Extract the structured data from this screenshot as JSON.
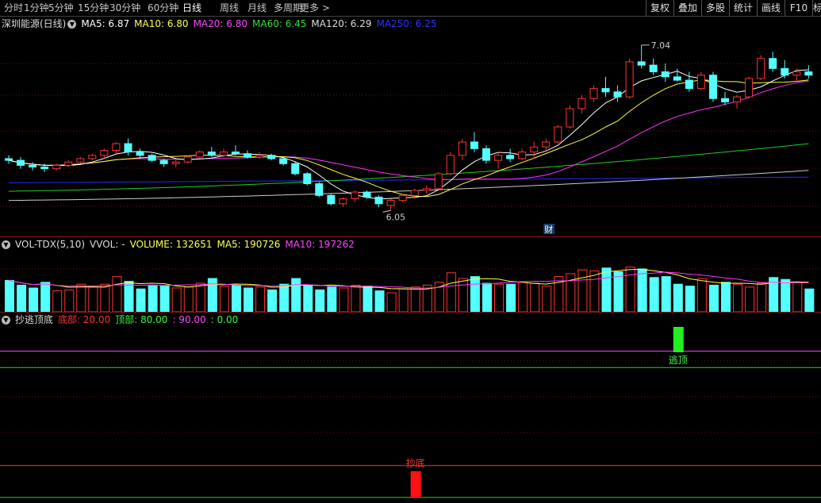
{
  "toolbar": {
    "period_tabs": [
      "分时",
      "1分钟",
      "5分钟",
      "15分钟",
      "30分钟",
      "60分钟",
      "日线",
      "周线",
      "月线",
      "多周期",
      "更多 >"
    ],
    "active_tab": "日线",
    "right_buttons": [
      "复权",
      "叠加",
      "多股",
      "统计",
      "画线",
      "F10",
      "标"
    ]
  },
  "price_panel": {
    "stock_name": "深圳能源(日线)",
    "ma_labels": [
      {
        "text": "MA5: 6.87",
        "color": "#ffffff"
      },
      {
        "text": "MA10: 6.80",
        "color": "#ffff55"
      },
      {
        "text": "MA20: 6.80",
        "color": "#ff44ff"
      },
      {
        "text": "MA60: 6.45",
        "color": "#33dd33"
      },
      {
        "text": "MA120: 6.29",
        "color": "#dddddd"
      },
      {
        "text": "MA250: 6.25",
        "color": "#3333ff"
      }
    ],
    "high_label": "7.04",
    "low_label": "6.05",
    "event_marker": "财"
  },
  "volume_panel": {
    "labels": [
      {
        "text": "VOL-TDX(5,10)",
        "color": "#dddddd"
      },
      {
        "text": "VVOL: -",
        "color": "#dddddd"
      },
      {
        "text": "VOLUME: 132651",
        "color": "#ffff55"
      },
      {
        "text": "MA5: 190726",
        "color": "#ffff55"
      },
      {
        "text": "MA10: 197262",
        "color": "#ff44ff"
      }
    ]
  },
  "signal_panel": {
    "labels": [
      {
        "text": "抄逃顶底",
        "color": "#dddddd"
      },
      {
        "text": "底部: 20.00",
        "color": "#ff3333"
      },
      {
        "text": "顶部: 80.00",
        "color": "#33ff33"
      },
      {
        "text": ": 90.00",
        "color": "#ff44ff"
      },
      {
        "text": ": 0.00",
        "color": "#33ff33"
      }
    ],
    "top_signal_label": "逃顶",
    "bottom_signal_label": "抄底"
  },
  "chart_data": {
    "type": "candlestick",
    "ylim": [
      5.98,
      7.12
    ],
    "up_color": "#ff3333",
    "down_color": "#54ffff",
    "candles": [
      [
        6.36,
        6.38,
        6.33,
        6.35
      ],
      [
        6.35,
        6.37,
        6.3,
        6.32
      ],
      [
        6.32,
        6.34,
        6.29,
        6.31
      ],
      [
        6.31,
        6.33,
        6.28,
        6.3
      ],
      [
        6.3,
        6.33,
        6.29,
        6.32
      ],
      [
        6.32,
        6.35,
        6.31,
        6.34
      ],
      [
        6.34,
        6.37,
        6.33,
        6.36
      ],
      [
        6.36,
        6.39,
        6.35,
        6.38
      ],
      [
        6.38,
        6.42,
        6.36,
        6.41
      ],
      [
        6.41,
        6.46,
        6.39,
        6.45
      ],
      [
        6.45,
        6.48,
        6.38,
        6.4
      ],
      [
        6.4,
        6.42,
        6.36,
        6.38
      ],
      [
        6.38,
        6.39,
        6.34,
        6.35
      ],
      [
        6.35,
        6.36,
        6.31,
        6.33
      ],
      [
        6.33,
        6.35,
        6.31,
        6.34
      ],
      [
        6.34,
        6.38,
        6.33,
        6.37
      ],
      [
        6.37,
        6.41,
        6.36,
        6.4
      ],
      [
        6.4,
        6.43,
        6.37,
        6.38
      ],
      [
        6.38,
        6.42,
        6.37,
        6.4
      ],
      [
        6.4,
        6.44,
        6.38,
        6.39
      ],
      [
        6.39,
        6.41,
        6.36,
        6.37
      ],
      [
        6.37,
        6.4,
        6.36,
        6.38
      ],
      [
        6.38,
        6.39,
        6.35,
        6.36
      ],
      [
        6.36,
        6.37,
        6.32,
        6.33
      ],
      [
        6.33,
        6.34,
        6.26,
        6.27
      ],
      [
        6.27,
        6.28,
        6.2,
        6.21
      ],
      [
        6.21,
        6.22,
        6.13,
        6.14
      ],
      [
        6.14,
        6.15,
        6.08,
        6.09
      ],
      [
        6.09,
        6.13,
        6.07,
        6.12
      ],
      [
        6.12,
        6.17,
        6.1,
        6.16
      ],
      [
        6.16,
        6.17,
        6.12,
        6.13
      ],
      [
        6.13,
        6.14,
        6.07,
        6.09
      ],
      [
        6.08,
        6.12,
        6.05,
        6.11
      ],
      [
        6.11,
        6.15,
        6.1,
        6.14
      ],
      [
        6.14,
        6.18,
        6.12,
        6.17
      ],
      [
        6.17,
        6.2,
        6.15,
        6.18
      ],
      [
        6.18,
        6.28,
        6.17,
        6.27
      ],
      [
        6.27,
        6.4,
        6.26,
        6.38
      ],
      [
        6.38,
        6.48,
        6.35,
        6.46
      ],
      [
        6.46,
        6.52,
        6.4,
        6.42
      ],
      [
        6.42,
        6.44,
        6.33,
        6.35
      ],
      [
        6.35,
        6.4,
        6.3,
        6.38
      ],
      [
        6.38,
        6.42,
        6.34,
        6.36
      ],
      [
        6.36,
        6.42,
        6.35,
        6.4
      ],
      [
        6.4,
        6.46,
        6.36,
        6.43
      ],
      [
        6.43,
        6.48,
        6.4,
        6.46
      ],
      [
        6.46,
        6.56,
        6.45,
        6.55
      ],
      [
        6.55,
        6.68,
        6.54,
        6.66
      ],
      [
        6.66,
        6.74,
        6.63,
        6.72
      ],
      [
        6.72,
        6.8,
        6.7,
        6.78
      ],
      [
        6.78,
        6.85,
        6.73,
        6.76
      ],
      [
        6.76,
        6.8,
        6.7,
        6.73
      ],
      [
        6.73,
        6.96,
        6.72,
        6.94
      ],
      [
        6.94,
        7.04,
        6.9,
        6.92
      ],
      [
        6.92,
        6.96,
        6.86,
        6.88
      ],
      [
        6.88,
        6.93,
        6.82,
        6.85
      ],
      [
        6.85,
        6.9,
        6.82,
        6.83
      ],
      [
        6.83,
        6.88,
        6.76,
        6.78
      ],
      [
        6.78,
        6.88,
        6.77,
        6.86
      ],
      [
        6.86,
        6.88,
        6.7,
        6.72
      ],
      [
        6.72,
        6.76,
        6.68,
        6.7
      ],
      [
        6.7,
        6.74,
        6.66,
        6.73
      ],
      [
        6.73,
        6.85,
        6.72,
        6.84
      ],
      [
        6.84,
        6.98,
        6.83,
        6.96
      ],
      [
        6.96,
        7.0,
        6.88,
        6.9
      ],
      [
        6.9,
        6.95,
        6.84,
        6.86
      ],
      [
        6.86,
        6.9,
        6.82,
        6.88
      ],
      [
        6.88,
        6.92,
        6.84,
        6.86
      ]
    ],
    "volume": [
      66,
      56,
      50,
      62,
      44,
      46,
      58,
      52,
      58,
      74,
      64,
      48,
      56,
      54,
      50,
      52,
      60,
      70,
      54,
      56,
      50,
      52,
      46,
      58,
      70,
      56,
      46,
      52,
      50,
      56,
      54,
      44,
      40,
      48,
      52,
      56,
      62,
      82,
      70,
      74,
      60,
      58,
      58,
      62,
      60,
      54,
      74,
      80,
      88,
      86,
      92,
      84,
      94,
      90,
      72,
      74,
      58,
      54,
      70,
      56,
      62,
      58,
      52,
      60,
      72,
      68,
      62,
      48
    ],
    "volume_ylim": [
      0,
      120
    ]
  }
}
